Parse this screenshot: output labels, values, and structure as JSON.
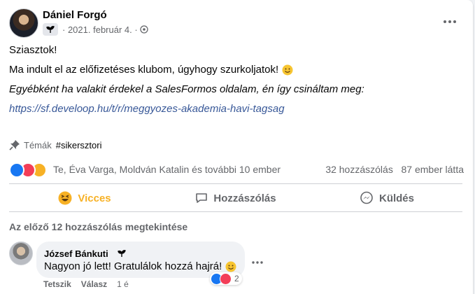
{
  "post": {
    "author": "Dániel Forgó",
    "date": "2021. február 4.",
    "lines": {
      "greeting": "Sziasztok!",
      "line2": "Ma indult el az előfizetéses klubom, úgyhogy szurkoljatok!",
      "line3": "Egyébként ha valakit érdekel a SalesFormos oldalam, én így csináltam meg:",
      "link": "https://sf.develoop.hu/t/r/meggyozes-akademia-havi-tagsag"
    },
    "topics_label": "Témák",
    "topic_tag": "#sikersztori",
    "reactions_people": "Te, Éva Varga, Moldván Katalin és további 10 ember",
    "comments_count": "32 hozzászólás",
    "seen_count": "87 ember látta"
  },
  "actions": {
    "react": "Vicces",
    "comment": "Hozzászólás",
    "share": "Küldés"
  },
  "comments": {
    "prev_label": "Az előző 12 hozzászólás megtekintése",
    "items": [
      {
        "author": "József Bánkuti",
        "text": "Nagyon jó lett! Gratulálok hozzá hajrá!",
        "reaction_count": "2",
        "like": "Tetszik",
        "reply": "Válasz",
        "time": "1 é"
      }
    ]
  },
  "colors": {
    "link": "#385898",
    "haha": "#f7b125",
    "like": "#1877f2",
    "love": "#f33e58"
  },
  "icons": [
    "more-icon",
    "globe-icon",
    "sprout-badge-icon",
    "pin-icon",
    "haha-icon",
    "comment-icon",
    "messenger-icon",
    "smile-emoji"
  ]
}
